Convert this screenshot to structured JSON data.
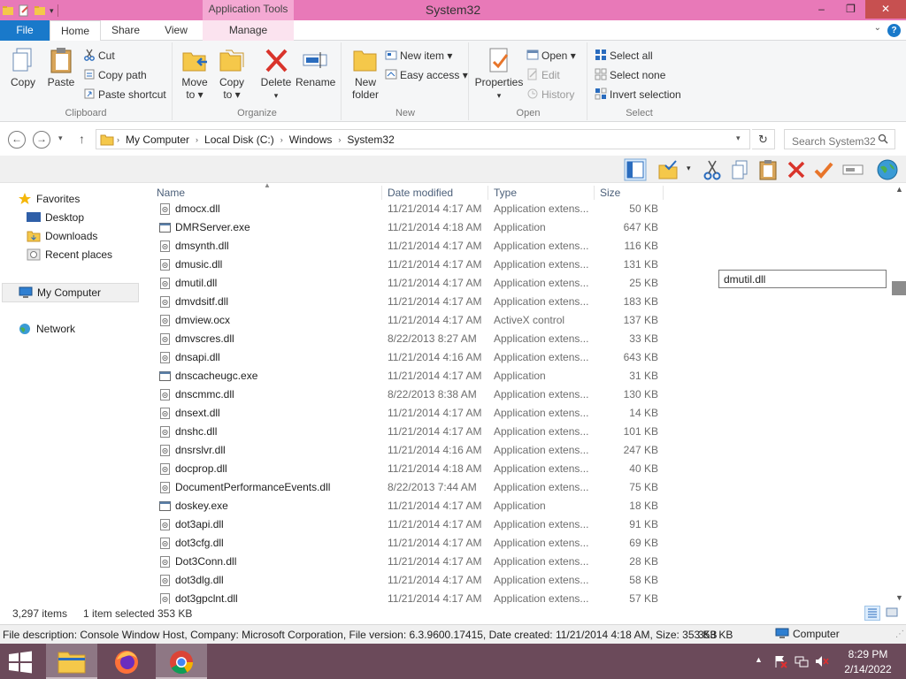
{
  "window": {
    "title": "System32",
    "contextual_tab_header": "Application Tools",
    "controls": {
      "minimize": "–",
      "maximize": "❐",
      "close": "✕"
    }
  },
  "ribbon_tabs": {
    "file": "File",
    "home": "Home",
    "share": "Share",
    "view": "View",
    "manage": "Manage"
  },
  "ribbon": {
    "clipboard": {
      "label": "Clipboard",
      "copy": "Copy",
      "paste": "Paste",
      "cut": "Cut",
      "copy_path": "Copy path",
      "paste_shortcut": "Paste shortcut"
    },
    "organize": {
      "label": "Organize",
      "move_to_1": "Move",
      "move_to_2": "to ▾",
      "copy_to_1": "Copy",
      "copy_to_2": "to ▾",
      "delete": "Delete",
      "delete_drop": "▾",
      "rename": "Rename"
    },
    "new": {
      "label": "New",
      "new_folder_1": "New",
      "new_folder_2": "folder",
      "new_item": "New item ▾",
      "easy_access": "Easy access ▾"
    },
    "open": {
      "label": "Open",
      "properties": "Properties",
      "properties_drop": "▾",
      "open": "Open ▾",
      "edit": "Edit",
      "history": "History"
    },
    "select": {
      "label": "Select",
      "select_all": "Select all",
      "select_none": "Select none",
      "invert_selection": "Invert selection"
    }
  },
  "address": {
    "crumbs": [
      "My Computer",
      "Local Disk (C:)",
      "Windows",
      "System32"
    ],
    "search_placeholder": "Search System32"
  },
  "nav": {
    "favorites": "Favorites",
    "desktop": "Desktop",
    "downloads": "Downloads",
    "recent_places": "Recent places",
    "my_computer": "My Computer",
    "network": "Network"
  },
  "columns": {
    "name": "Name",
    "date_modified": "Date modified",
    "type": "Type",
    "size": "Size"
  },
  "files": [
    {
      "name": "dmocx.dll",
      "date": "11/21/2014 4:17 AM",
      "type": "Application extens...",
      "size": "50 KB",
      "kind": "dll"
    },
    {
      "name": "DMRServer.exe",
      "date": "11/21/2014 4:18 AM",
      "type": "Application",
      "size": "647 KB",
      "kind": "exe"
    },
    {
      "name": "dmsynth.dll",
      "date": "11/21/2014 4:17 AM",
      "type": "Application extens...",
      "size": "116 KB",
      "kind": "dll"
    },
    {
      "name": "dmusic.dll",
      "date": "11/21/2014 4:17 AM",
      "type": "Application extens...",
      "size": "131 KB",
      "kind": "dll"
    },
    {
      "name": "dmutil.dll",
      "date": "11/21/2014 4:17 AM",
      "type": "Application extens...",
      "size": "25 KB",
      "kind": "dll"
    },
    {
      "name": "dmvdsitf.dll",
      "date": "11/21/2014 4:17 AM",
      "type": "Application extens...",
      "size": "183 KB",
      "kind": "dll"
    },
    {
      "name": "dmview.ocx",
      "date": "11/21/2014 4:17 AM",
      "type": "ActiveX control",
      "size": "137 KB",
      "kind": "dll"
    },
    {
      "name": "dmvscres.dll",
      "date": "8/22/2013 8:27 AM",
      "type": "Application extens...",
      "size": "33 KB",
      "kind": "dll"
    },
    {
      "name": "dnsapi.dll",
      "date": "11/21/2014 4:16 AM",
      "type": "Application extens...",
      "size": "643 KB",
      "kind": "dll"
    },
    {
      "name": "dnscacheugc.exe",
      "date": "11/21/2014 4:17 AM",
      "type": "Application",
      "size": "31 KB",
      "kind": "exe"
    },
    {
      "name": "dnscmmc.dll",
      "date": "8/22/2013 8:38 AM",
      "type": "Application extens...",
      "size": "130 KB",
      "kind": "dll"
    },
    {
      "name": "dnsext.dll",
      "date": "11/21/2014 4:17 AM",
      "type": "Application extens...",
      "size": "14 KB",
      "kind": "dll"
    },
    {
      "name": "dnshc.dll",
      "date": "11/21/2014 4:17 AM",
      "type": "Application extens...",
      "size": "101 KB",
      "kind": "dll"
    },
    {
      "name": "dnsrslvr.dll",
      "date": "11/21/2014 4:16 AM",
      "type": "Application extens...",
      "size": "247 KB",
      "kind": "dll"
    },
    {
      "name": "docprop.dll",
      "date": "11/21/2014 4:18 AM",
      "type": "Application extens...",
      "size": "40 KB",
      "kind": "dll"
    },
    {
      "name": "DocumentPerformanceEvents.dll",
      "date": "8/22/2013 7:44 AM",
      "type": "Application extens...",
      "size": "75 KB",
      "kind": "dll"
    },
    {
      "name": "doskey.exe",
      "date": "11/21/2014 4:17 AM",
      "type": "Application",
      "size": "18 KB",
      "kind": "exe"
    },
    {
      "name": "dot3api.dll",
      "date": "11/21/2014 4:17 AM",
      "type": "Application extens...",
      "size": "91 KB",
      "kind": "dll"
    },
    {
      "name": "dot3cfg.dll",
      "date": "11/21/2014 4:17 AM",
      "type": "Application extens...",
      "size": "69 KB",
      "kind": "dll"
    },
    {
      "name": "Dot3Conn.dll",
      "date": "11/21/2014 4:17 AM",
      "type": "Application extens...",
      "size": "28 KB",
      "kind": "dll"
    },
    {
      "name": "dot3dlg.dll",
      "date": "11/21/2014 4:17 AM",
      "type": "Application extens...",
      "size": "58 KB",
      "kind": "dll"
    },
    {
      "name": "dot3gpclnt.dll",
      "date": "11/21/2014 4:17 AM",
      "type": "Application extens...",
      "size": "57 KB",
      "kind": "dll"
    }
  ],
  "rename_box": "dmutil.dll",
  "status": {
    "items": "3,297 items",
    "selected": "1 item selected",
    "selected_size": "353 KB"
  },
  "description": {
    "text": "File description: Console Window Host, Company: Microsoft Corporation, File version: 6.3.9600.17415, Date created: 11/21/2014 4:18 AM, Size: 353 KB",
    "size": "353 KB",
    "location": "Computer"
  },
  "taskbar": {
    "time": "8:29 PM",
    "date": "2/14/2022"
  },
  "colors": {
    "titlebar": "#e879b8",
    "file_tab": "#1979ca",
    "taskbar": "#6b4a5a",
    "close_button": "#c75050"
  }
}
